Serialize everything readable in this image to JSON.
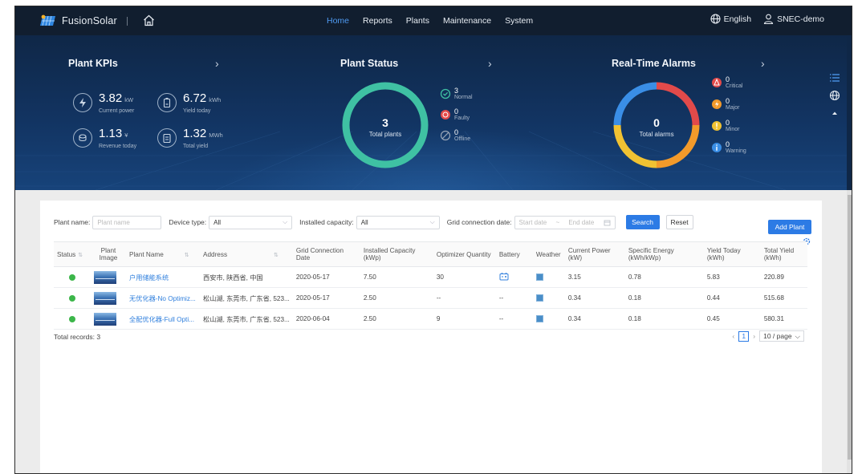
{
  "topbar": {
    "app_name": "FusionSolar",
    "nav": [
      "Home",
      "Reports",
      "Plants",
      "Maintenance",
      "System"
    ],
    "active_nav": "Home",
    "language": "English",
    "user": "SNEC-demo"
  },
  "kpis": {
    "title": "Plant KPIs",
    "current_power": {
      "value": "3.82",
      "unit": "kW",
      "label": "Current power"
    },
    "yield_today": {
      "value": "6.72",
      "unit": "kWh",
      "label": "Yield today"
    },
    "revenue_today": {
      "value": "1.13",
      "unit": "¥",
      "label": "Revenue today"
    },
    "total_yield": {
      "value": "1.32",
      "unit": "MWh",
      "label": "Total yield"
    }
  },
  "plant_status": {
    "title": "Plant Status",
    "total": "3",
    "total_label": "Total plants",
    "normal": {
      "count": "3",
      "label": "Normal"
    },
    "faulty": {
      "count": "0",
      "label": "Faulty"
    },
    "offline": {
      "count": "0",
      "label": "Offline"
    },
    "ring_color": "#3fc1a3"
  },
  "alarms": {
    "title": "Real-Time Alarms",
    "total": "0",
    "total_label": "Total alarms",
    "critical": {
      "count": "0",
      "label": "Critical"
    },
    "major": {
      "count": "0",
      "label": "Major"
    },
    "minor": {
      "count": "0",
      "label": "Minor"
    },
    "warning": {
      "count": "0",
      "label": "Warning"
    },
    "colors": {
      "critical": "#e24a4a",
      "major": "#f39a2a",
      "minor": "#f1c232",
      "warning": "#3a8ee6"
    }
  },
  "filters": {
    "plant_name_label": "Plant name:",
    "plant_name_placeholder": "Plant name",
    "device_type_label": "Device type:",
    "device_type_value": "All",
    "capacity_label": "Installed capacity:",
    "capacity_value": "All",
    "grid_date_label": "Grid connection date:",
    "start_date_placeholder": "Start date",
    "end_date_placeholder": "End date",
    "date_sep": "~",
    "search_label": "Search",
    "reset_label": "Reset",
    "add_label": "Add Plant"
  },
  "table": {
    "headers": {
      "status": "Status",
      "image": "Plant Image",
      "name": "Plant Name",
      "address": "Address",
      "grid_date": "Grid Connection Date",
      "capacity": "Installed Capacity (kWp)",
      "optimizer": "Optimizer Quantity",
      "battery": "Battery",
      "weather": "Weather",
      "power": "Current Power (kW)",
      "specific": "Specific Energy (kWh/kWp)",
      "yield_today": "Yield Today (kWh)",
      "total_yield": "Total Yield (kWh)"
    },
    "rows": [
      {
        "name": "户用储能系统",
        "address": "西安市, 陕西省, 中国",
        "grid_date": "2020-05-17",
        "capacity": "7.50",
        "optimizer": "30",
        "battery": "icon",
        "power": "3.15",
        "specific": "0.78",
        "yield_today": "5.83",
        "total_yield": "220.89"
      },
      {
        "name": "无优化器-No Optimiz...",
        "address": "松山湖, 东莞市, 广东省, 523...",
        "grid_date": "2020-05-17",
        "capacity": "2.50",
        "optimizer": "--",
        "battery": "--",
        "power": "0.34",
        "specific": "0.18",
        "yield_today": "0.44",
        "total_yield": "515.68"
      },
      {
        "name": "全配优化器-Full Opti...",
        "address": "松山湖, 东莞市, 广东省, 523...",
        "grid_date": "2020-06-04",
        "capacity": "2.50",
        "optimizer": "9",
        "battery": "--",
        "power": "0.34",
        "specific": "0.18",
        "yield_today": "0.45",
        "total_yield": "580.31"
      }
    ],
    "total_records": "Total records: 3",
    "page": "1",
    "page_size": "10 / page"
  }
}
